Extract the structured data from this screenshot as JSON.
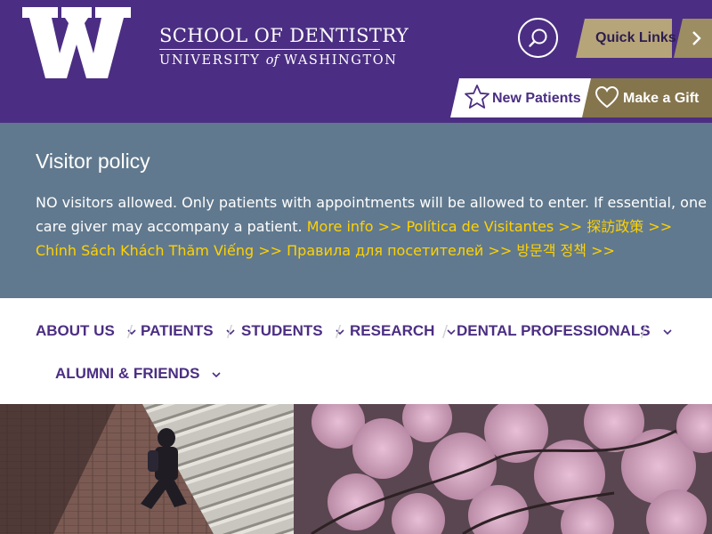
{
  "header": {
    "logo_letter": "W",
    "school_name": "SCHOOL OF DENTISTRY",
    "university_pre": "UNIVERSITY",
    "university_of": "of",
    "university_post": "WASHINGTON",
    "search_icon": "search-icon",
    "quick_links_label": "Quick Links",
    "new_patients_label": "New Patients",
    "make_gift_label": "Make a Gift",
    "colors": {
      "purple": "#4b2e83",
      "gold": "#b7a57a",
      "dark_gold": "#85754d"
    }
  },
  "alert": {
    "title": "Visitor policy",
    "text_line1": "NO visitors allowed. Only patients with appointments will be allowed to enter. If essential, one",
    "text_line2_prefix": "care giver may accompany a patient.",
    "link_more_info": "More info >>",
    "link_spanish": "Política de Visitantes >>",
    "link_chinese": "探訪政策 >>",
    "link_vietnamese": "Chính Sách Khách Thăm Viếng >>",
    "link_russian": "Правила для посетителей >>",
    "link_korean": "방문객 정책 >>",
    "colors": {
      "background": "#61798e",
      "link": "#ffd200"
    }
  },
  "nav": {
    "items": [
      {
        "label": "ABOUT US"
      },
      {
        "label": "PATIENTS"
      },
      {
        "label": "STUDENTS"
      },
      {
        "label": "RESEARCH"
      },
      {
        "label": "DENTAL PROFESSIONALS"
      },
      {
        "label": "ALUMNI & FRIENDS"
      }
    ],
    "separator": "/"
  },
  "hero": {
    "description_icon": "hero-image"
  }
}
